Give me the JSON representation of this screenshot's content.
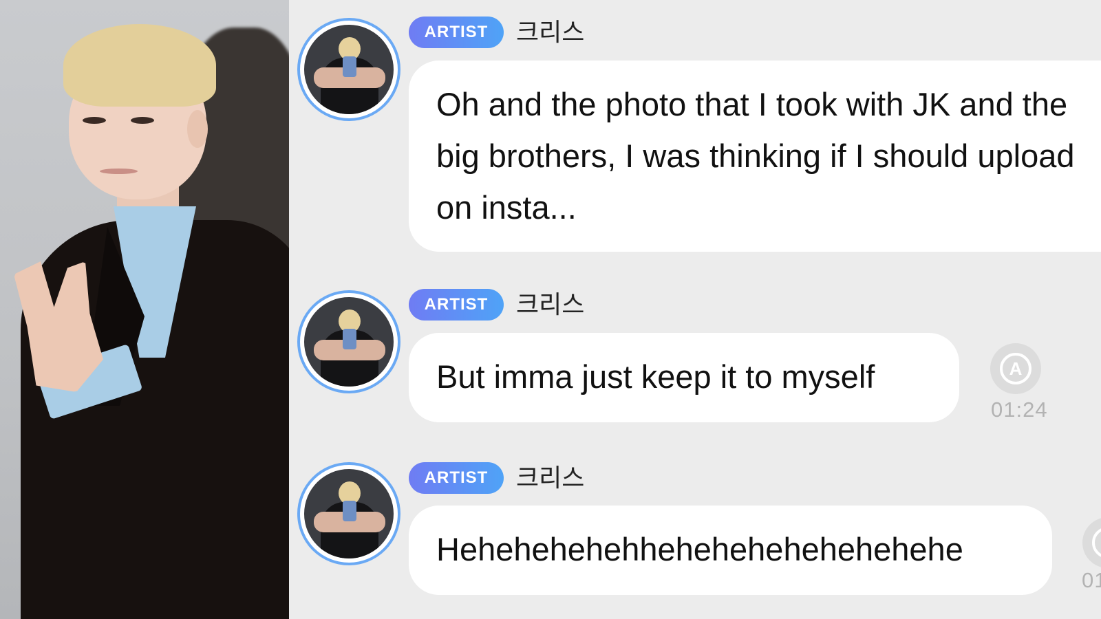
{
  "photo": {
    "subject": "person-photo"
  },
  "messages": [
    {
      "badge": "ARTIST",
      "sender": "크리스",
      "text": "Oh and the photo that I took with JK and the big brothers, I was thinking if I should upload on insta..."
    },
    {
      "badge": "ARTIST",
      "sender": "크리스",
      "text": "But imma just keep it to myself",
      "translate_icon": "A",
      "time": "01:24"
    },
    {
      "badge": "ARTIST",
      "sender": "크리스",
      "text": "Hehehehehehhehehehehehehehehe",
      "translate_icon": "A",
      "time": "01"
    }
  ],
  "colors": {
    "badge_start": "#6f7cf3",
    "badge_end": "#4fa3f7",
    "avatar_ring": "#6aa9f4",
    "chat_bg": "#ececec",
    "bubble_bg": "#ffffff"
  }
}
